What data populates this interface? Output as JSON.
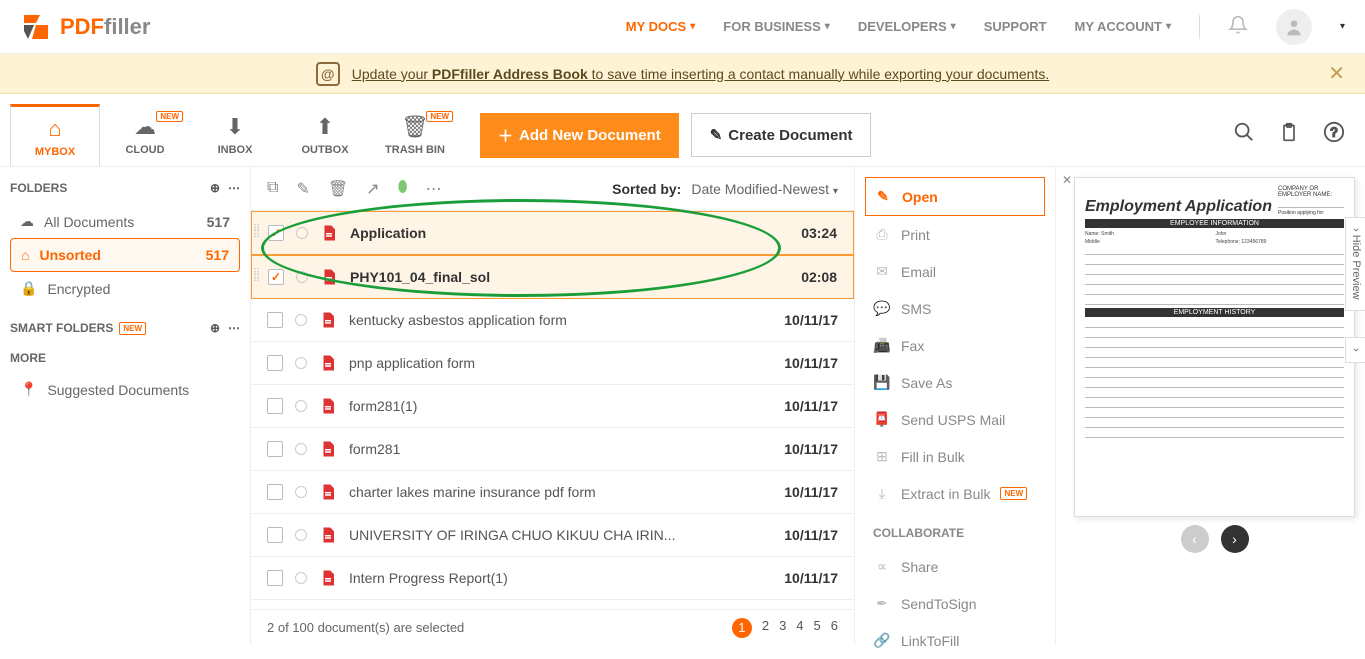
{
  "logo": {
    "brand1": "PDF",
    "brand2": "filler"
  },
  "topnav": {
    "mydocs": "MY DOCS",
    "business": "FOR BUSINESS",
    "developers": "DEVELOPERS",
    "support": "SUPPORT",
    "account": "MY ACCOUNT"
  },
  "banner": {
    "prefix": "Update your ",
    "bold": "PDFfiller Address Book",
    "suffix": " to save time inserting a contact manually while exporting your documents."
  },
  "tabs": {
    "mybox": "MYBOX",
    "cloud": "CLOUD",
    "inbox": "INBOX",
    "outbox": "OUTBOX",
    "trash": "TRASH BIN",
    "new": "NEW"
  },
  "buttons": {
    "add": "Add New Document",
    "create": "Create Document"
  },
  "side": {
    "folders": "FOLDERS",
    "all": "All Documents",
    "all_count": "517",
    "unsorted": "Unsorted",
    "unsorted_count": "517",
    "encrypted": "Encrypted",
    "smart": "SMART FOLDERS",
    "new": "NEW",
    "more": "MORE",
    "suggested": "Suggested Documents"
  },
  "list": {
    "sorted_by": "Sorted by:",
    "sort_val": "Date Modified-Newest",
    "rows": [
      {
        "name": "Application",
        "date": "03:24",
        "checked": true
      },
      {
        "name": "PHY101_04_final_sol",
        "date": "02:08",
        "checked": true
      },
      {
        "name": "kentucky asbestos application form",
        "date": "10/11/17",
        "checked": false
      },
      {
        "name": "pnp application form",
        "date": "10/11/17",
        "checked": false
      },
      {
        "name": "form281(1)",
        "date": "10/11/17",
        "checked": false
      },
      {
        "name": "form281",
        "date": "10/11/17",
        "checked": false
      },
      {
        "name": "charter lakes marine insurance pdf form",
        "date": "10/11/17",
        "checked": false
      },
      {
        "name": "UNIVERSITY OF IRINGA CHUO KIKUU CHA IRIN...",
        "date": "10/11/17",
        "checked": false
      },
      {
        "name": "Intern Progress Report(1)",
        "date": "10/11/17",
        "checked": false
      }
    ],
    "footer": "2 of 100 document(s) are selected",
    "pages": [
      "1",
      "2",
      "3",
      "4",
      "5",
      "6"
    ]
  },
  "actions": {
    "open": "Open",
    "print": "Print",
    "email": "Email",
    "sms": "SMS",
    "fax": "Fax",
    "saveas": "Save As",
    "usps": "Send USPS Mail",
    "bulk": "Fill in Bulk",
    "extract": "Extract in Bulk",
    "new": "NEW",
    "collab": "COLLABORATE",
    "share": "Share",
    "sendtosign": "SendToSign",
    "linktofill": "LinkToFill"
  },
  "preview": {
    "title": "Employment Application",
    "company": "COMPANY OR EMPLOYER NAME:",
    "position": "Position applying for:",
    "sec1": "EMPLOYEE INFORMATION",
    "sec2": "EMPLOYMENT HISTORY",
    "hide": "Hide Preview"
  }
}
